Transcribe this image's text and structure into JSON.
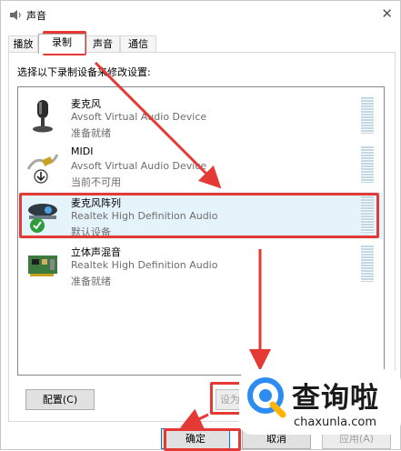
{
  "window": {
    "title": "声音",
    "close_glyph": "✕"
  },
  "tabs": [
    {
      "label": "播放"
    },
    {
      "label": "录制"
    },
    {
      "label": "声音"
    },
    {
      "label": "通信"
    }
  ],
  "instruction": "选择以下录制设备来修改设置:",
  "devices": [
    {
      "name": "麦克风",
      "description": "Avsoft Virtual Audio Device",
      "status": "准备就绪",
      "icon": "microphone-icon"
    },
    {
      "name": "MIDI",
      "description": "Avsoft Virtual Audio Device",
      "status": "当前不可用",
      "icon": "midi-cable-icon"
    },
    {
      "name": "麦克风阵列",
      "description": "Realtek High Definition Audio",
      "status": "默认设备",
      "icon": "webcam-microphone-icon",
      "selected": true
    },
    {
      "name": "立体声混音",
      "description": "Realtek High Definition Audio",
      "status": "准备就绪",
      "icon": "sound-card-icon"
    }
  ],
  "buttons": {
    "configure": "配置(C)",
    "set_default": "设为",
    "ok": "确定",
    "cancel": "取消",
    "apply": "应用(A)"
  },
  "watermark": {
    "name": "查询啦",
    "url": "chaxunla.com"
  },
  "colors": {
    "highlight": "#e53935",
    "accent": "#0078d7",
    "selection": "#e5f3fb"
  }
}
